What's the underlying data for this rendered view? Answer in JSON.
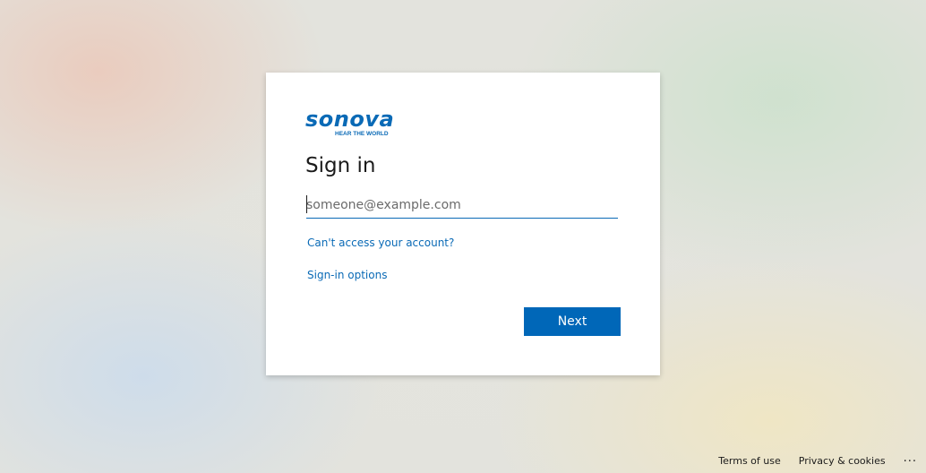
{
  "brand": {
    "name": "sonova",
    "tagline": "HEAR THE WORLD",
    "color": "#0a6ab6"
  },
  "signin": {
    "title": "Sign in",
    "email_placeholder": "someone@example.com",
    "email_value": "",
    "cant_access_link": "Can't access your account?",
    "signin_options_link": "Sign-in options",
    "next_button": "Next",
    "button_color": "#0067b8"
  },
  "footer": {
    "terms": "Terms of use",
    "privacy": "Privacy & cookies",
    "more": "..."
  }
}
